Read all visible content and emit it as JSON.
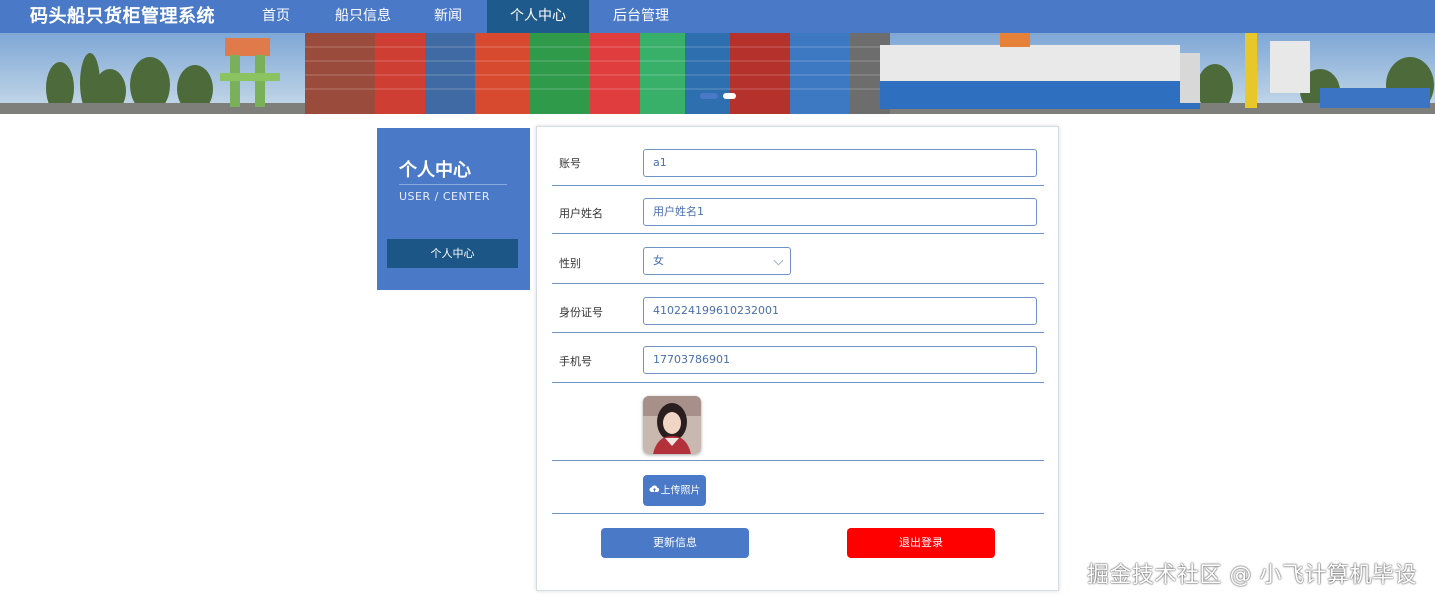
{
  "header": {
    "brand": "码头船只货柜管理系统",
    "nav": [
      {
        "label": "首页"
      },
      {
        "label": "船只信息"
      },
      {
        "label": "新闻"
      },
      {
        "label": "个人中心",
        "active": true
      },
      {
        "label": "后台管理"
      }
    ]
  },
  "sidebar": {
    "title": "个人中心",
    "subtitle": "USER / CENTER",
    "button_label": "个人中心"
  },
  "form": {
    "account": {
      "label": "账号",
      "value": "a1"
    },
    "name": {
      "label": "用户姓名",
      "value": "用户姓名1"
    },
    "gender": {
      "label": "性别",
      "value": "女"
    },
    "id_number": {
      "label": "身份证号",
      "value": "410224199610232001"
    },
    "phone": {
      "label": "手机号",
      "value": "17703786901"
    },
    "upload_label": "上传照片",
    "update_label": "更新信息",
    "logout_label": "退出登录"
  },
  "watermark": "掘金技术社区 @ 小飞计算机毕设",
  "colors": {
    "primary": "#4a79c8",
    "nav_active": "#1f5a8d",
    "sidebar_button": "#1b5687",
    "danger": "#ff0000",
    "field_border": "#6f93c9"
  }
}
